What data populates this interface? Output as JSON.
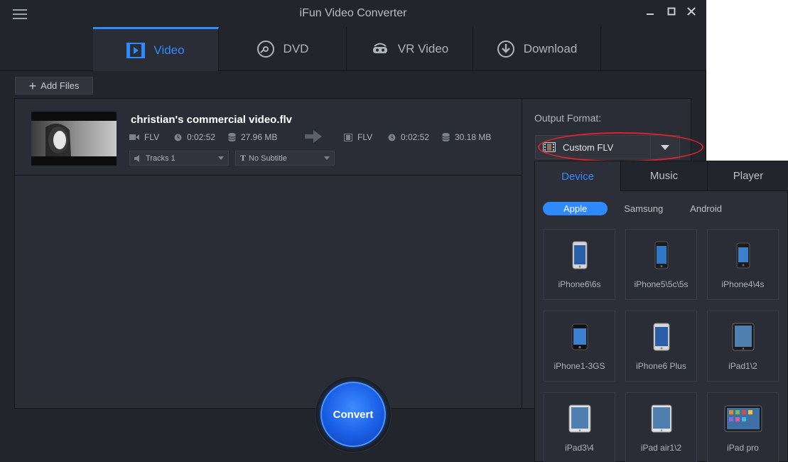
{
  "window": {
    "title": "iFun Video Converter"
  },
  "tabs": [
    {
      "label": "Video",
      "icon": "video-icon"
    },
    {
      "label": "DVD",
      "icon": "dvd-icon"
    },
    {
      "label": "VR Video",
      "icon": "vr-headset-icon"
    },
    {
      "label": "Download",
      "icon": "download-icon"
    }
  ],
  "toolbar": {
    "add_files": "Add Files"
  },
  "file": {
    "name": "christian's commercial video.flv",
    "source": {
      "format": "FLV",
      "duration": "0:02:52",
      "size": "27.96 MB"
    },
    "output": {
      "format": "FLV",
      "duration": "0:02:52",
      "size": "30.18 MB"
    },
    "tracks": "Tracks 1",
    "subtitle": "No Subtitle"
  },
  "output_format": {
    "label": "Output Format:",
    "value": "Custom FLV"
  },
  "convert": {
    "label": "Convert"
  },
  "popup": {
    "tabs": [
      "Device",
      "Music",
      "Player"
    ],
    "brands": [
      "Apple",
      "Samsung",
      "Android"
    ],
    "devices": [
      "iPhone6\\6s",
      "iPhone5\\5c\\5s",
      "iPhone4\\4s",
      "iPhone1-3GS",
      "iPhone6 Plus",
      "iPad1\\2",
      "iPad3\\4",
      "iPad air1\\2",
      "iPad pro"
    ]
  },
  "colors": {
    "accent": "#2f89ff",
    "background": "#22252c",
    "panel": "#2a2d35",
    "highlight_ring": "#d9252b"
  }
}
